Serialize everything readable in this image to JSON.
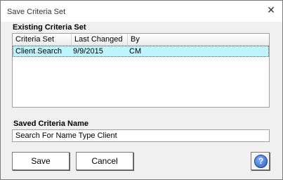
{
  "window": {
    "title": "Save Criteria Set",
    "close_glyph": "✕"
  },
  "existing_section": {
    "label": "Existing  Criteria Set"
  },
  "list": {
    "columns": [
      "Criteria Set Name",
      "Last Changed",
      "By"
    ],
    "rows": [
      {
        "name": "Client Search",
        "last_changed": "9/9/2015",
        "by": "CM",
        "selected": true
      }
    ]
  },
  "saved_name_section": {
    "label": "Saved Criteria Name",
    "value": "Search For Name Type Client"
  },
  "buttons": {
    "save": "Save",
    "cancel": "Cancel",
    "help_glyph": "?"
  },
  "colors": {
    "selected_row": "#bff5ff",
    "dialog_bg": "#f0f0f0",
    "help_icon": "#2a5db8"
  }
}
